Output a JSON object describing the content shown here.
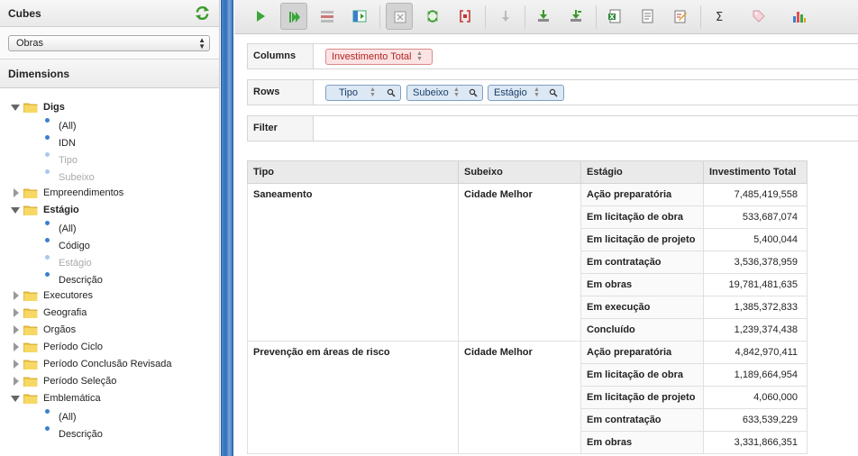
{
  "left_panel": {
    "cubes_title": "Cubes",
    "cube_selected": "Obras",
    "dimensions_title": "Dimensions",
    "tree": [
      {
        "label": "Digs",
        "open": true,
        "bold": true,
        "children": [
          {
            "label": "(All)",
            "disabled": false
          },
          {
            "label": "IDN",
            "disabled": false
          },
          {
            "label": "Tipo",
            "disabled": true
          },
          {
            "label": "Subeixo",
            "disabled": true
          }
        ]
      },
      {
        "label": "Empreendimentos",
        "open": false,
        "bold": false,
        "children": []
      },
      {
        "label": "Estágio",
        "open": true,
        "bold": true,
        "children": [
          {
            "label": "(All)",
            "disabled": false
          },
          {
            "label": "Código",
            "disabled": false
          },
          {
            "label": "Estágio",
            "disabled": true
          },
          {
            "label": "Descrição",
            "disabled": false
          }
        ]
      },
      {
        "label": "Executores",
        "open": false,
        "bold": false,
        "children": []
      },
      {
        "label": "Geografia",
        "open": false,
        "bold": false,
        "children": []
      },
      {
        "label": "Orgãos",
        "open": false,
        "bold": false,
        "children": []
      },
      {
        "label": "Período Ciclo",
        "open": false,
        "bold": false,
        "children": []
      },
      {
        "label": "Período Conclusão Revisada",
        "open": false,
        "bold": false,
        "children": []
      },
      {
        "label": "Período Seleção",
        "open": false,
        "bold": false,
        "children": []
      },
      {
        "label": "Emblemática",
        "open": true,
        "bold": false,
        "children": [
          {
            "label": "(All)",
            "disabled": false
          },
          {
            "label": "Descrição",
            "disabled": false
          }
        ]
      }
    ]
  },
  "toolbar": {
    "icons": [
      "run-icon",
      "auto-run-icon",
      "toggle-fields-icon",
      "hide-parents-icon",
      "non-empty-icon",
      "swap-axes-icon",
      "show-mdx-icon",
      "drill-down-icon",
      "export-xls-icon",
      "export-csv-icon",
      "export-pdf-icon",
      "edit-icon",
      "sum-icon",
      "tag-icon",
      "chart-icon"
    ]
  },
  "axes": {
    "columns_label": "Columns",
    "rows_label": "Rows",
    "filter_label": "Filter",
    "columns": [
      "Investimento Total"
    ],
    "rows": [
      "Tipo",
      "Subeixo",
      "Estágio"
    ]
  },
  "table": {
    "headers": [
      "Tipo",
      "Subeixo",
      "Estágio",
      "Investimento Total"
    ],
    "groups": [
      {
        "tipo": "Saneamento",
        "subeixo": "Cidade Melhor",
        "rows": [
          {
            "estagio": "Ação preparatória",
            "valor": "7,485,419,558"
          },
          {
            "estagio": "Em licitação de obra",
            "valor": "533,687,074"
          },
          {
            "estagio": "Em licitação de projeto",
            "valor": "5,400,044"
          },
          {
            "estagio": "Em contratação",
            "valor": "3,536,378,959"
          },
          {
            "estagio": "Em obras",
            "valor": "19,781,481,635"
          },
          {
            "estagio": "Em execução",
            "valor": "1,385,372,833"
          },
          {
            "estagio": "Concluído",
            "valor": "1,239,374,438"
          }
        ]
      },
      {
        "tipo": "Prevenção em áreas de risco",
        "subeixo": "Cidade Melhor",
        "rows": [
          {
            "estagio": "Ação preparatória",
            "valor": "4,842,970,411"
          },
          {
            "estagio": "Em licitação de obra",
            "valor": "1,189,664,954"
          },
          {
            "estagio": "Em licitação de projeto",
            "valor": "4,060,000"
          },
          {
            "estagio": "Em contratação",
            "valor": "633,539,229"
          },
          {
            "estagio": "Em obras",
            "valor": "3,331,866,351"
          }
        ]
      }
    ]
  }
}
